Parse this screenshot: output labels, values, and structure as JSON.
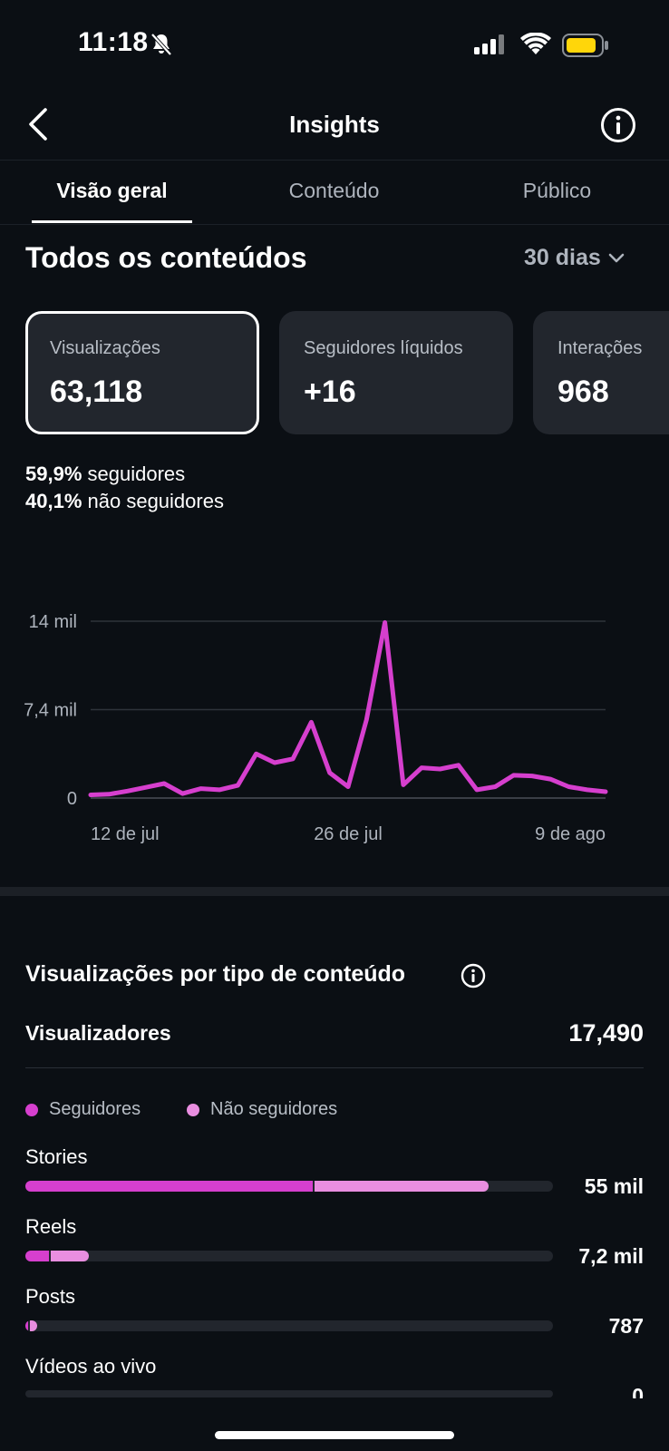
{
  "status": {
    "time": "11:18"
  },
  "header": {
    "title": "Insights"
  },
  "tabs": [
    {
      "label": "Visão geral",
      "active": true
    },
    {
      "label": "Conteúdo",
      "active": false
    },
    {
      "label": "Público",
      "active": false
    }
  ],
  "section": {
    "title": "Todos os conteúdos",
    "range": "30 dias"
  },
  "cards": [
    {
      "label": "Visualizações",
      "value": "63,118"
    },
    {
      "label": "Seguidores líquidos",
      "value": "+16"
    },
    {
      "label": "Interações",
      "value": "968"
    }
  ],
  "split": {
    "followers_pct": "59,9%",
    "followers_label": "seguidores",
    "non_followers_pct": "40,1%",
    "non_followers_label": "não seguidores"
  },
  "chart_data": {
    "type": "line",
    "y_ticks": [
      "14 mil",
      "7,4 mil",
      "0"
    ],
    "x_ticks": [
      "12 de jul",
      "26 de jul",
      "9 de ago"
    ],
    "ylim": [
      0,
      14000
    ],
    "grid": true,
    "color": "#d63fce",
    "x": [
      "11/07",
      "12/07",
      "13/07",
      "14/07",
      "15/07",
      "16/07",
      "17/07",
      "18/07",
      "19/07",
      "20/07",
      "21/07",
      "22/07",
      "23/07",
      "24/07",
      "25/07",
      "26/07",
      "27/07",
      "28/07",
      "29/07",
      "30/07",
      "31/07",
      "01/08",
      "02/08",
      "03/08",
      "04/08",
      "05/08",
      "06/08",
      "07/08",
      "08/08",
      "09/08",
      "10/08"
    ],
    "values": [
      250,
      300,
      550,
      850,
      1150,
      350,
      750,
      650,
      1000,
      3500,
      2800,
      3100,
      6000,
      2000,
      900,
      6200,
      13900,
      1050,
      2400,
      2300,
      2600,
      650,
      900,
      1800,
      1750,
      1500,
      900,
      650,
      500
    ]
  },
  "by_type": {
    "title": "Visualizações por tipo de conteúdo",
    "viewers_label": "Visualizadores",
    "viewers_value": "17,490",
    "legend": [
      {
        "label": "Seguidores",
        "color": "#d63fce"
      },
      {
        "label": "Não seguidores",
        "color": "#e98ee0"
      }
    ],
    "rows": [
      {
        "label": "Stories",
        "value": "55 mil",
        "followers_frac": 0.545,
        "non_followers_frac": 0.33
      },
      {
        "label": "Reels",
        "value": "7,2 mil",
        "followers_frac": 0.045,
        "non_followers_frac": 0.072
      },
      {
        "label": "Posts",
        "value": "787",
        "followers_frac": 0.005,
        "non_followers_frac": 0.013
      },
      {
        "label": "Vídeos ao vivo",
        "value": "0",
        "followers_frac": 0,
        "non_followers_frac": 0
      }
    ]
  }
}
